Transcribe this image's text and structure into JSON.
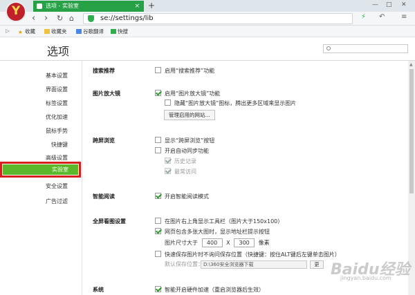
{
  "browser": {
    "tab_title": "选项 - 实验室",
    "tab_close": "×",
    "new_tab": "+",
    "address": "se://settings/lib",
    "back": "‹",
    "forward": "›",
    "reload": "↻",
    "home": "⌂",
    "menu_btn": "≡",
    "win_min": "—",
    "win_max": "□",
    "win_close": "✕",
    "bookmarks": [
      "收藏",
      "收藏夹",
      "谷歌翻译",
      "快搜"
    ],
    "accent": "#26a146"
  },
  "page": {
    "title": "选项",
    "search_placeholder": ""
  },
  "sidebar": {
    "items": [
      "基本设置",
      "界面设置",
      "标签设置",
      "优化加速",
      "鼠标手势",
      "快捷键",
      "高级设置",
      "实验室",
      "安全设置",
      "广告过滤"
    ],
    "active_index": 7,
    "active_color": "#5cb82b"
  },
  "sections": {
    "search_rec": {
      "title": "搜索推荐",
      "opt1": "启用“搜索推荐”功能"
    },
    "magnifier": {
      "title": "图片放大镜",
      "opt1": "启用“图片放大镜”功能",
      "opt2": "隐藏“图片放大镜”图标，腾出更多区域来显示图片",
      "button": "管理启用的网站..."
    },
    "cross_screen": {
      "title": "跨屏浏览",
      "opt1": "显示“跨屏浏览”按钮",
      "opt2": "开启自动同步功能",
      "opt3": "历史记录",
      "opt4": "最常访问"
    },
    "smart_read": {
      "title": "智能阅读",
      "opt1": "开启智能阅读模式"
    },
    "fullscreen_img": {
      "title": "全屏看图设置",
      "opt1": "在图片右上角显示工具栏（图片大于150x100）",
      "opt2": "网页包含多张大图时，显示地址栏提示按钮",
      "size_label": "图片尺寸大于",
      "width": "400",
      "x": "X",
      "height": "300",
      "unit": "像素",
      "opt3": "快速保存图片时不询问保存位置（快捷键：按住ALT键后左键单击图片）",
      "path_label": "默认保存位置：",
      "path": "D:\\360安全浏览器下载",
      "more": "更"
    },
    "system": {
      "title": "系统",
      "opt1": "智能开启硬件加速（重启浏览器后生效）"
    }
  },
  "watermark": {
    "text": "Baidu经验",
    "sub": "jingyan.baidu.com"
  }
}
